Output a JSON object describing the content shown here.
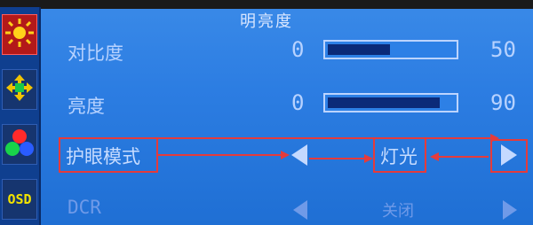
{
  "menu": {
    "title": "明亮度"
  },
  "sidebar": {
    "items": [
      {
        "name": "brightness",
        "icon": "sun-icon"
      },
      {
        "name": "position",
        "icon": "four-arrow-move-icon"
      },
      {
        "name": "color",
        "icon": "rgb-circles-icon"
      },
      {
        "name": "osd",
        "icon": "osd-text-icon",
        "text": "OSD"
      }
    ]
  },
  "settings": {
    "contrast": {
      "label": "对比度",
      "min": "0",
      "value": "50",
      "level": 0.5
    },
    "brightness": {
      "label": "亮度",
      "min": "0",
      "value": "90",
      "level": 0.9
    },
    "eye_mode": {
      "label": "护眼模式",
      "value": "灯光"
    },
    "dcr": {
      "label": "DCR",
      "value": "关闭"
    }
  },
  "colors": {
    "accent_red": "#e53b3b",
    "bg_blue": "#2c7de2"
  }
}
